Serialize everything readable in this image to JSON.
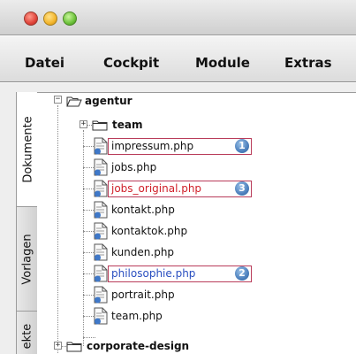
{
  "window": {
    "controls": [
      "close",
      "minimize",
      "zoom"
    ]
  },
  "menu": [
    "Datei",
    "Cockpit",
    "Module",
    "Extras"
  ],
  "side_tabs": [
    {
      "label": "Dokumente",
      "active": true
    },
    {
      "label": "Vorlagen",
      "active": false
    },
    {
      "label": "ekte",
      "active": false
    }
  ],
  "tree": {
    "root": {
      "label": "agentur",
      "expander": "−",
      "icon": "folder-open-icon"
    },
    "team_folder": {
      "label": "team",
      "expander": "+",
      "icon": "folder-icon"
    },
    "files": [
      {
        "label": "impressum.php",
        "style": "normal",
        "badge": "1"
      },
      {
        "label": "jobs.php",
        "style": "normal",
        "badge": ""
      },
      {
        "label": "jobs_original.php",
        "style": "red",
        "badge": "3"
      },
      {
        "label": "kontakt.php",
        "style": "normal",
        "badge": ""
      },
      {
        "label": "kontaktok.php",
        "style": "normal",
        "badge": ""
      },
      {
        "label": "kunden.php",
        "style": "normal",
        "badge": ""
      },
      {
        "label": "philosophie.php",
        "style": "blue",
        "badge": "2"
      },
      {
        "label": "portrait.php",
        "style": "normal",
        "badge": ""
      },
      {
        "label": "team.php",
        "style": "normal",
        "badge": ""
      }
    ],
    "sibling_folder": {
      "label": "corporate-design",
      "expander": "+",
      "icon": "folder-icon"
    }
  },
  "colors": {
    "highlight_border": "#b93c5a",
    "red_text": "#d0202a",
    "blue_text": "#2a4fc0",
    "badge_blue": "#4d80bd"
  }
}
